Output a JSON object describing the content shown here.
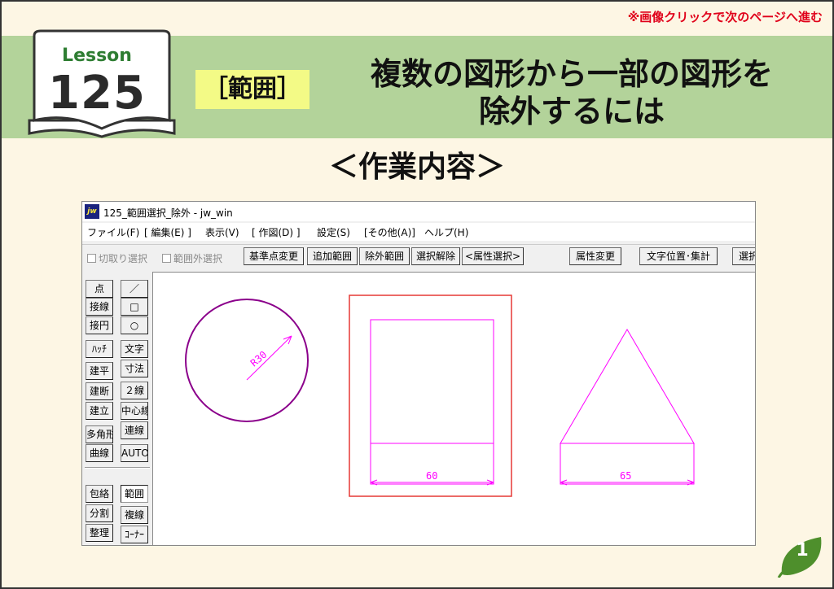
{
  "slide": {
    "top_note": "※画像クリックで次のページへ進む",
    "lesson_label": "Lesson",
    "lesson_number": "125",
    "category": "［範囲］",
    "title_line1": "複数の図形から一部の図形を",
    "title_line2": "除外するには",
    "work_heading": "＜作業内容＞",
    "page_number": "1",
    "colors": {
      "banner": "#b3d39a",
      "category_bg": "#f3fa86",
      "note": "#e0001a",
      "leaf": "#4e8f2c"
    }
  },
  "window": {
    "title": "125_範囲選択_除外 - jw_win",
    "app_icon": "jw",
    "menu": [
      "ファイル(F)",
      "[ 編集(E) ]",
      "表示(V)",
      "[ 作図(D) ]",
      "設定(S)",
      "[その他(A)]",
      "ヘルプ(H)"
    ],
    "toolbar": {
      "checkbox_cut": "切取り選択",
      "checkbox_outside": "範囲外選択",
      "buttons": [
        "基準点変更",
        "追加範囲",
        "除外範囲",
        "選択解除",
        "<属性選択>",
        "属性変更",
        "文字位置･集計",
        "選択"
      ]
    },
    "left_tools": {
      "col1": [
        "点",
        "接線",
        "接円",
        "ﾊｯﾁ",
        "建平",
        "建断",
        "建立",
        "多角形",
        "曲線",
        "包絡",
        "分割",
        "整理"
      ],
      "col2": [
        "／",
        "□",
        "○",
        "文字",
        "寸法",
        "２線",
        "中心線",
        "連線",
        "AUTO",
        "範囲",
        "複線",
        "ｺｰﾅｰ"
      ]
    }
  },
  "drawing": {
    "radius_label": "R30",
    "rect_dimension": "60",
    "triangle_dimension": "65",
    "colors": {
      "circle": "#8b008b",
      "shape": "#ff00ff",
      "selection": "#e53935"
    }
  }
}
